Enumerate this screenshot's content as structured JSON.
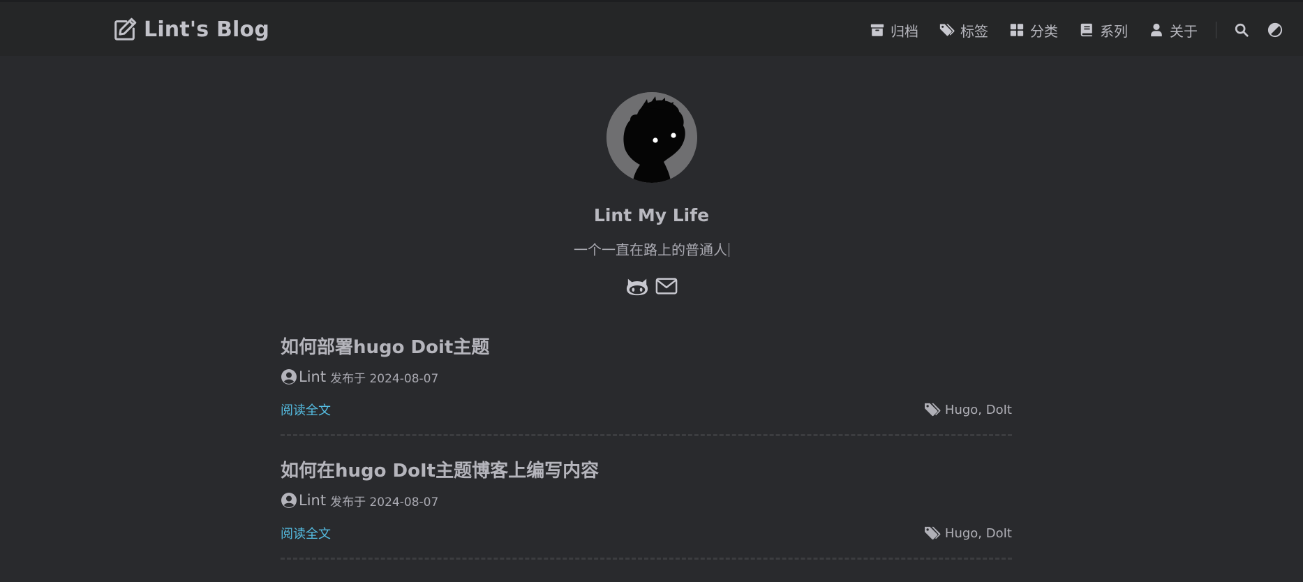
{
  "site": {
    "brand_title": "Lint's Blog",
    "brand_icon": "edit-icon"
  },
  "nav": {
    "items": [
      {
        "label": "归档",
        "icon": "archive-icon"
      },
      {
        "label": "标签",
        "icon": "tags-icon"
      },
      {
        "label": "分类",
        "icon": "th-large-icon"
      },
      {
        "label": "系列",
        "icon": "book-icon"
      },
      {
        "label": "关于",
        "icon": "user-icon"
      }
    ],
    "tools": [
      {
        "icon": "search-icon"
      },
      {
        "icon": "theme-toggle-icon"
      }
    ]
  },
  "profile": {
    "name": "Lint My Life",
    "subtitle": "一个一直在路上的普通人",
    "social": [
      {
        "icon": "github-icon"
      },
      {
        "icon": "email-icon"
      }
    ]
  },
  "posts": [
    {
      "title": "如何部署hugo Doit主题",
      "author": "Lint",
      "published_label": "发布于 2024-08-07",
      "read_more": "阅读全文",
      "tags": "Hugo, DoIt"
    },
    {
      "title": "如何在hugo DoIt主题博客上编写内容",
      "author": "Lint",
      "published_label": "发布于 2024-08-07",
      "read_more": "阅读全文",
      "tags": "Hugo, DoIt"
    }
  ],
  "colors": {
    "background": "#292a2d",
    "header": "#252627",
    "link_accent": "#55bde2",
    "text": "#a9a9b3"
  }
}
